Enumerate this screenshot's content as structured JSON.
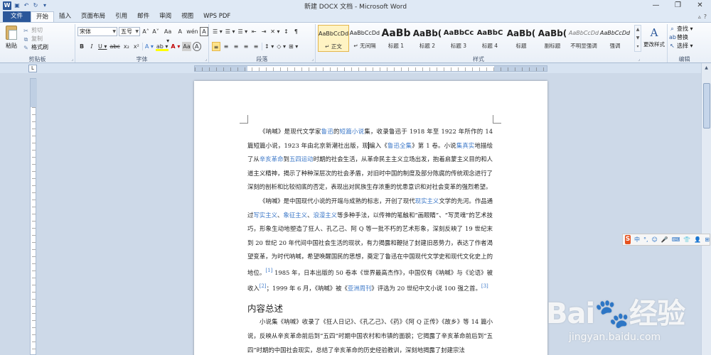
{
  "window": {
    "title": "新建 DOCX 文档 - Microsoft Word",
    "app_icon": "W",
    "quick_access": [
      "save-icon",
      "undo-icon",
      "redo-icon",
      "customize-icon"
    ],
    "controls": [
      "—",
      "❐",
      "✕"
    ]
  },
  "tabs": [
    "文件",
    "开始",
    "插入",
    "页面布局",
    "引用",
    "邮件",
    "审阅",
    "视图",
    "WPS PDF"
  ],
  "active_tab": "开始",
  "ribbon": {
    "clipboard": {
      "label": "剪贴板",
      "paste": "粘贴",
      "cut": "剪切",
      "copy": "复制",
      "format_painter": "格式刷"
    },
    "font": {
      "label": "字体",
      "font_name": "宋体",
      "font_size": "五号",
      "row1": [
        "A˄",
        "A˅",
        "Aa ▾",
        "A",
        "wén",
        "A"
      ],
      "row2": [
        "B",
        "I",
        "U ▾",
        "abc",
        "x₂",
        "x²",
        "A ▾",
        "ab ▾",
        "A ▾",
        "Aa",
        "A"
      ]
    },
    "paragraph": {
      "label": "段落",
      "row1": [
        "☰ ▾",
        "☰ ▾",
        "☰ ▾",
        "⇤",
        "⇥",
        "✕ ▾",
        "↕",
        "¶"
      ],
      "row2": [
        "≡",
        "≡",
        "≡",
        "≡",
        "≡",
        "↕ ▾",
        "◇ ▾",
        "⊞ ▾"
      ]
    },
    "styles": {
      "label": "样式",
      "items": [
        {
          "sample": "AaBbCcDd",
          "name": "↵ 正文"
        },
        {
          "sample": "AaBbCcDd",
          "name": "↵ 无间隔"
        },
        {
          "sample": "AaBb",
          "name": "标题 1"
        },
        {
          "sample": "AaBb(",
          "name": "标题 2"
        },
        {
          "sample": "AaBbCc",
          "name": "标题 3"
        },
        {
          "sample": "AaBbC",
          "name": "标题 4"
        },
        {
          "sample": "AaBb(",
          "name": "标题"
        },
        {
          "sample": "AaBb(",
          "name": "副标题"
        },
        {
          "sample": "AaBbCcDd",
          "name": "不明显强调"
        },
        {
          "sample": "AaBbCcDd",
          "name": "强调"
        }
      ],
      "change_styles": "更改样式"
    },
    "editing": {
      "label": "编辑",
      "find": "查找 ▾",
      "replace": "替换",
      "select": "选择 ▾"
    }
  },
  "document": {
    "p1": {
      "t1": "《呐喊》是现代文学家",
      "l1": "鲁迅",
      "t2": "的",
      "l2": "短篇小说",
      "t3": "集，收录鲁迅于 1918 年至 1922 年所作的 14 篇短篇小说，1923 年由北京新潮社出版，现",
      "t3b": "编入《",
      "l3": "鲁迅全集",
      "t4": "》第 1 卷。小说",
      "l4": "集真实",
      "t5": "地描绘了从",
      "l5": "辛亥革命",
      "t6": "到",
      "l6": "五四运动",
      "t7": "时期的社会生活，从革命民主主义立场出发，抱着启蒙主义目的和人道主义精神，揭示了种种深层次的社会矛盾，对旧时中国的制度及部分陈腐的传统观念进行了深刻的剖析和比较彻底的否定，表现出对民族生存浓重的忧患意识和对社会变革的强烈希望。"
    },
    "p2": {
      "t1": "《呐喊》是中国现代小说的开端与成熟的标志，开创了现代",
      "l1": "现实主义",
      "t2": "文学的先河。作品通过",
      "l2": "写实主义",
      "t3": "、",
      "l3": "象征主义",
      "t4": "、",
      "l4": "浪漫主义",
      "t5": "等多种手法，以传神的笔触和“画眼睛”、“写灵魂”的艺术技巧，形象生动地塑造了狂人、孔乙己、阿 Q 等一批不朽的艺术形象，深刻反映了 19 世纪末到 20 世纪 20 年代间中国社会生活的现状，有力揭露和鞭挞了封建旧恶势力，表达了作者渴望变革，为时代呐喊，希望唤醒国民的思想，奠定了鲁迅在中国现代文学史和现代文化史上的地位。",
      "r1": "[1]",
      "t6": " 1985 年，日本出版的 50 卷本《世界最高杰作》，中国仅有《呐喊》与《论语》被收入",
      "r2": "[2]",
      "t7": "；1999 年 6 月，《呐喊》被《",
      "l5": "亚洲周刊",
      "t8": "》评选为 20 世纪中文小说 100 强之首。",
      "r3": "[3]"
    },
    "heading": "内容总述",
    "p3": "小说集《呐喊》收录了《狂人日记》、《孔乙己》、《药》《阿 Q 正传》《故乡》等 14 篇小说，反映从辛亥革命前后到“五四”时期中国农村和市镇的面貌；它揭露了辛亥革命前后到“五四”时期的中国社会现实，总结了辛亥革命的历史经验教训，深刻地揭露了封建宗法"
  },
  "ime": {
    "logo": "S",
    "items": [
      "中",
      "°,",
      "☺",
      "🎤",
      "⌨",
      "👕",
      "👤",
      "⊞"
    ]
  },
  "watermark": {
    "brand": "Bai🐾经验",
    "url": "jingyan.baidu.com"
  },
  "colors": {
    "accent": "#2b579a",
    "link": "#3c78c8",
    "ribbon_bg": "#e9eff7",
    "workspace_bg": "#cdd9e8"
  }
}
